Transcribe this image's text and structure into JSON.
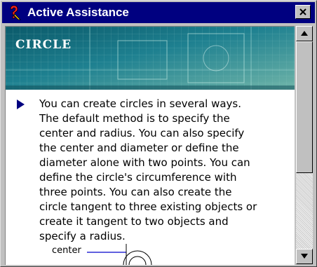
{
  "window": {
    "title": "Active Assistance",
    "close_icon": "close-icon",
    "help_icon": "question-mark-icon"
  },
  "banner": {
    "title": "CIRCLE"
  },
  "body": {
    "bullet_icon": "triangle-bullet-icon",
    "lines": [
      "You can create circles in several ways.",
      "The default method is to specify the",
      "center and radius. You can also specify",
      "the center and diameter or define the",
      "diameter alone with two points. You can",
      "define the circle's circumference with",
      "three points. You can also create the",
      "circle tangent to three existing objects or",
      "create it tangent to two objects and",
      "specify a radius."
    ]
  },
  "diagram": {
    "label": "center"
  },
  "scrollbar": {
    "position_fraction": 0.0
  }
}
